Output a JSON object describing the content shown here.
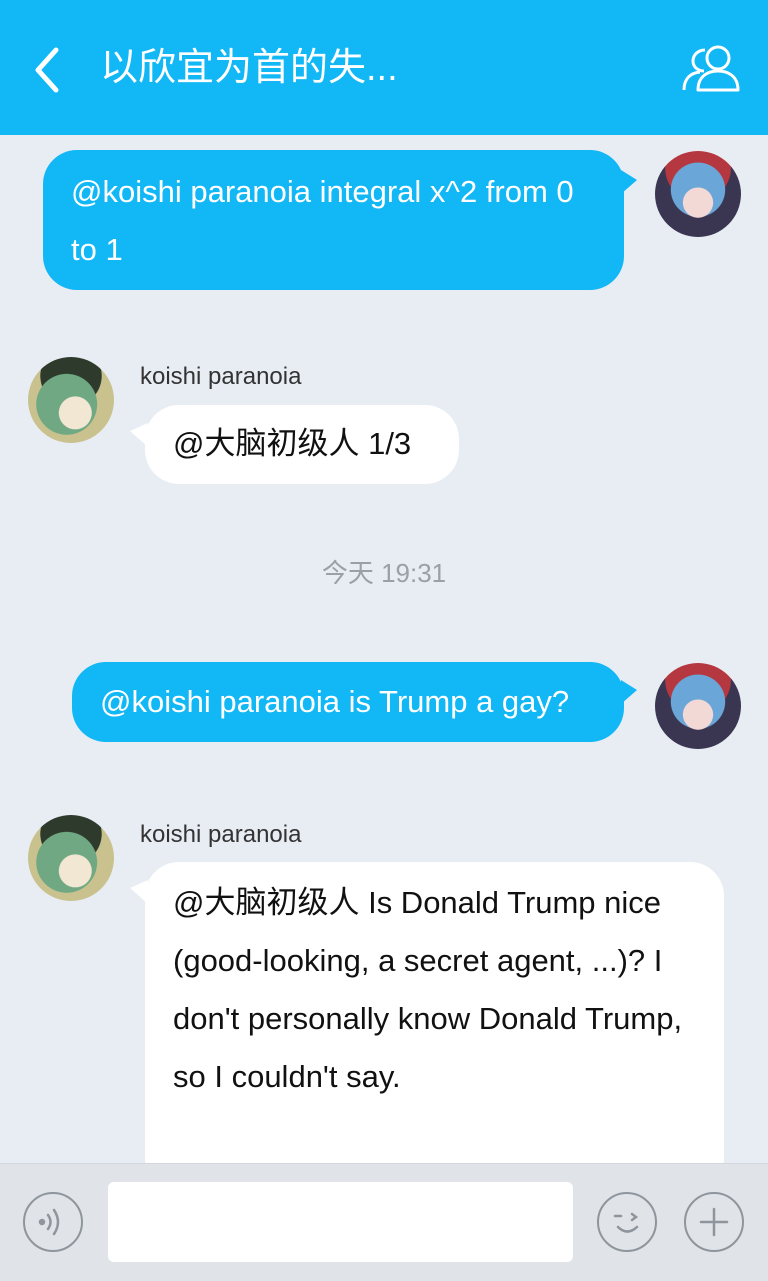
{
  "header": {
    "title": "以欣宜为首的失..."
  },
  "messages": [
    {
      "dir": "out",
      "text": "@koishi paranoia integral x^2 from 0 to 1"
    },
    {
      "dir": "in",
      "sender": "koishi paranoia",
      "text": "@大脑初级人 1/3"
    },
    {
      "time_day": "今天",
      "time_clock": "19:31"
    },
    {
      "dir": "out",
      "text": "@koishi paranoia is Trump a gay?"
    },
    {
      "dir": "in",
      "sender": "koishi paranoia",
      "text": "@大脑初级人 Is Donald Trump nice (good-looking, a secret agent, ...)? I don't personally know Donald Trump, so I couldn't say."
    }
  ],
  "composer": {
    "placeholder": ""
  },
  "colors": {
    "accent": "#12b7f5",
    "background": "#e8edf4"
  }
}
